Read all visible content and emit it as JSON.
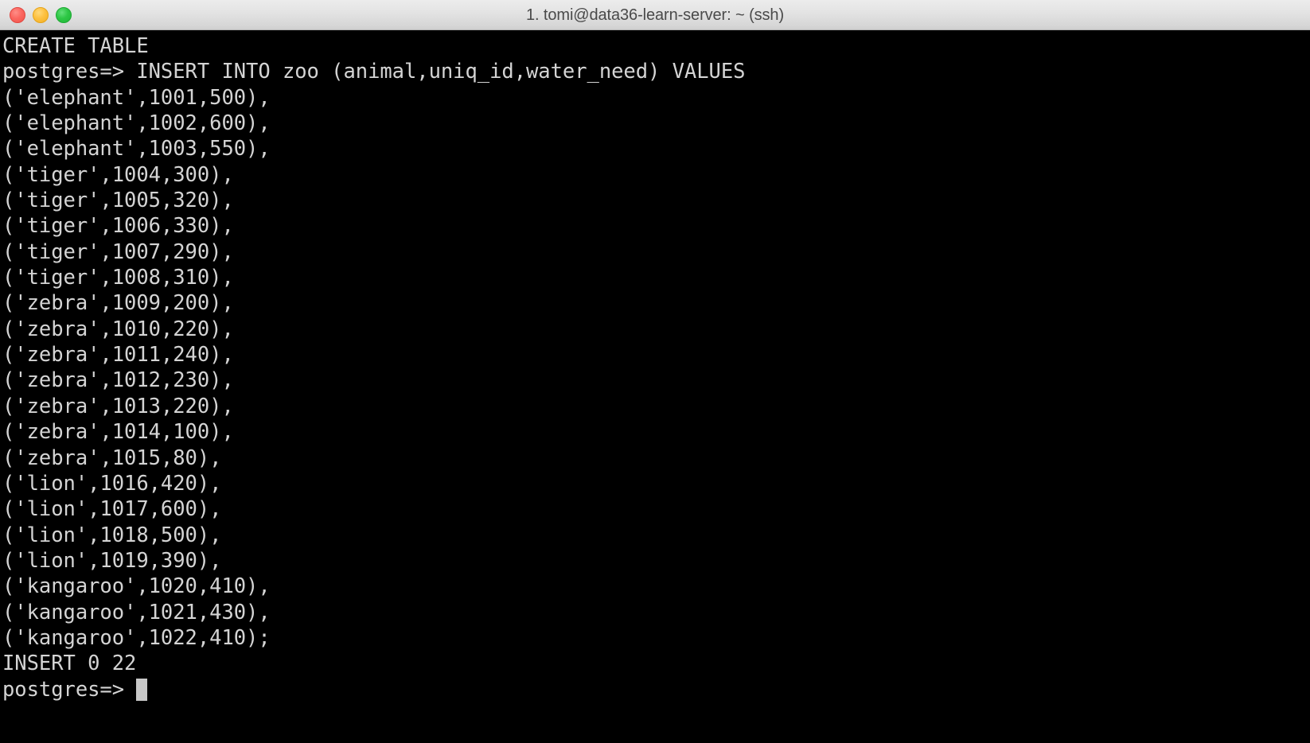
{
  "window": {
    "title": "1. tomi@data36-learn-server: ~ (ssh)",
    "traffic_lights": [
      {
        "name": "close",
        "color": "#fb6760"
      },
      {
        "name": "minimize",
        "color": "#fdc141"
      },
      {
        "name": "zoom",
        "color": "#2ec745"
      }
    ]
  },
  "theme": {
    "terminal_background": "#000000",
    "terminal_foreground": "#d4d4d4",
    "titlebar_background": "#e4e4e4",
    "titlebar_foreground": "#4a4a4a",
    "cursor_color": "#c8c8c8"
  },
  "terminal": {
    "prompt": "postgres=>",
    "lines": [
      "CREATE TABLE",
      "postgres=> INSERT INTO zoo (animal,uniq_id,water_need) VALUES",
      "('elephant',1001,500),",
      "('elephant',1002,600),",
      "('elephant',1003,550),",
      "('tiger',1004,300),",
      "('tiger',1005,320),",
      "('tiger',1006,330),",
      "('tiger',1007,290),",
      "('tiger',1008,310),",
      "('zebra',1009,200),",
      "('zebra',1010,220),",
      "('zebra',1011,240),",
      "('zebra',1012,230),",
      "('zebra',1013,220),",
      "('zebra',1014,100),",
      "('zebra',1015,80),",
      "('lion',1016,420),",
      "('lion',1017,600),",
      "('lion',1018,500),",
      "('lion',1019,390),",
      "('kangaroo',1020,410),",
      "('kangaroo',1021,430),",
      "('kangaroo',1022,410);",
      "INSERT 0 22"
    ],
    "last_prompt": "postgres=> "
  },
  "sql_data": {
    "statement": "INSERT INTO zoo (animal,uniq_id,water_need) VALUES",
    "table": "zoo",
    "columns": [
      "animal",
      "uniq_id",
      "water_need"
    ],
    "rows": [
      [
        "elephant",
        1001,
        500
      ],
      [
        "elephant",
        1002,
        600
      ],
      [
        "elephant",
        1003,
        550
      ],
      [
        "tiger",
        1004,
        300
      ],
      [
        "tiger",
        1005,
        320
      ],
      [
        "tiger",
        1006,
        330
      ],
      [
        "tiger",
        1007,
        290
      ],
      [
        "tiger",
        1008,
        310
      ],
      [
        "zebra",
        1009,
        200
      ],
      [
        "zebra",
        1010,
        220
      ],
      [
        "zebra",
        1011,
        240
      ],
      [
        "zebra",
        1012,
        230
      ],
      [
        "zebra",
        1013,
        220
      ],
      [
        "zebra",
        1014,
        100
      ],
      [
        "zebra",
        1015,
        80
      ],
      [
        "lion",
        1016,
        420
      ],
      [
        "lion",
        1017,
        600
      ],
      [
        "lion",
        1018,
        500
      ],
      [
        "lion",
        1019,
        390
      ],
      [
        "kangaroo",
        1020,
        410
      ],
      [
        "kangaroo",
        1021,
        430
      ],
      [
        "kangaroo",
        1022,
        410
      ]
    ],
    "result_previous": "CREATE TABLE",
    "result": "INSERT 0 22",
    "rows_inserted": 22
  }
}
